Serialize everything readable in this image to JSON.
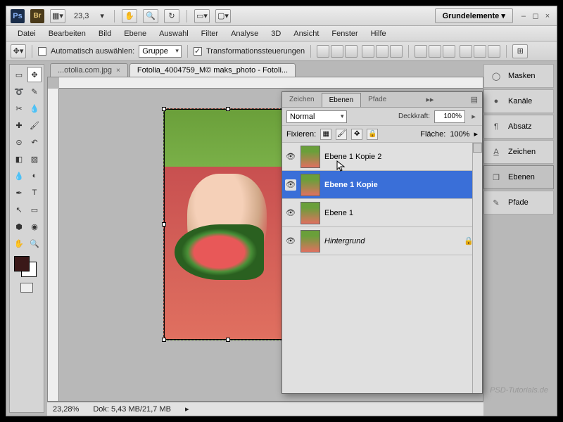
{
  "topbar": {
    "zoom": "23,3",
    "workspace": "Grundelemente"
  },
  "menu": [
    "Datei",
    "Bearbeiten",
    "Bild",
    "Ebene",
    "Auswahl",
    "Filter",
    "Analyse",
    "3D",
    "Ansicht",
    "Fenster",
    "Hilfe"
  ],
  "options": {
    "auto_select": "Automatisch auswählen:",
    "auto_select_value": "Gruppe",
    "transform": "Transformationssteuerungen"
  },
  "tabs": [
    {
      "label": "...otolia.com.jpg",
      "active": false
    },
    {
      "label": "Fotolia_4004759_M© maks_photo - Fotoli...",
      "active": true
    }
  ],
  "status": {
    "zoom": "23,28%",
    "doc": "Dok: 5,43 MB/21,7 MB"
  },
  "layers_panel": {
    "tabs": [
      "Zeichen",
      "Ebenen",
      "Pfade"
    ],
    "active_tab": 1,
    "blend_mode": "Normal",
    "opacity_label": "Deckkraft:",
    "opacity": "100%",
    "lock_label": "Fixieren:",
    "fill_label": "Fläche:",
    "fill": "100%",
    "layers": [
      {
        "name": "Ebene 1 Kopie 2",
        "visible": true,
        "selected": false,
        "locked": false
      },
      {
        "name": "Ebene 1 Kopie",
        "visible": true,
        "selected": true,
        "locked": false
      },
      {
        "name": "Ebene 1",
        "visible": true,
        "selected": false,
        "locked": false
      },
      {
        "name": "Hintergrund",
        "visible": true,
        "selected": false,
        "locked": true,
        "italic": true
      }
    ]
  },
  "right_panels": [
    {
      "label": "Masken",
      "icon": "◯"
    },
    {
      "label": "Kanäle",
      "icon": "●"
    },
    {
      "label": "Absatz",
      "icon": "¶"
    },
    {
      "label": "Zeichen",
      "icon": "A"
    },
    {
      "label": "Ebenen",
      "icon": "❐",
      "selected": true
    },
    {
      "label": "Pfade",
      "icon": "✎"
    }
  ],
  "watermark": "PSD-Tutorials.de"
}
